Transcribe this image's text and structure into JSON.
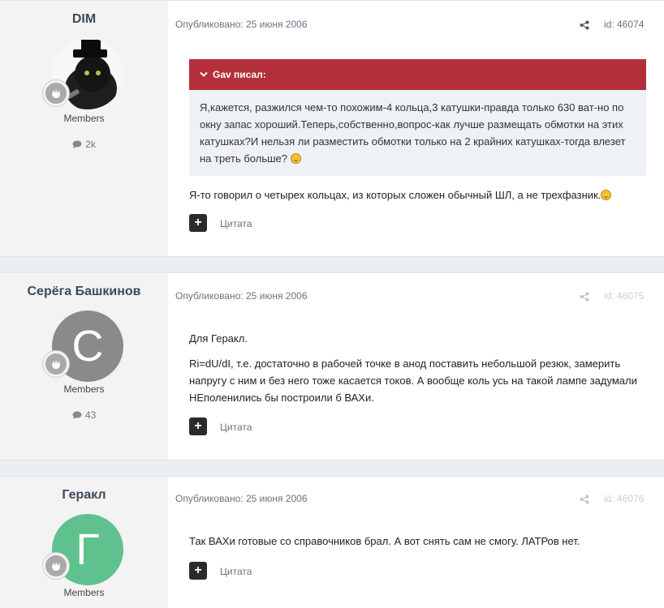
{
  "posts": [
    {
      "author": "DIM",
      "group": "Members",
      "post_count": "2k",
      "published_label": "Опубликовано: 25 июня 2006",
      "id_label": "id: 46074",
      "quote": {
        "author_label": "Gav писал:",
        "text": "Я,кажется, разжился чем-то похожим-4 кольца,3 катушки-правда только 630 ват-но по окну запас хороший.Теперь,собственно,вопрос-как лучше размещать обмотки на этих катушках?И нельзя ли разместить обмотки только на 2 крайних катушках-тогда влезет на треть больше?"
      },
      "text": "Я-то говорил о четырех кольцах, из которых сложен обычный ШЛ, а не трехфазник.",
      "quote_button": "Цитата"
    },
    {
      "author": "Серёга Башкинов",
      "avatar_letter": "С",
      "avatar_color": "#8a8a8a",
      "group": "Members",
      "post_count": "43",
      "published_label": "Опубликовано: 25 июня 2006",
      "id_label": "id: 46075",
      "paragraphs": [
        "Для Геракл.",
        "Ri=dU/dI, т.е. достаточно в рабочей точке в анод поставить небольшой резюк, замерить напругу с ним и без него тоже касается токов. А вообще коль усь на такой лампе задумали НЕполенились бы построили б ВАХи."
      ],
      "quote_button": "Цитата"
    },
    {
      "author": "Геракл",
      "avatar_letter": "Г",
      "avatar_color": "#5fc28e",
      "group": "Members",
      "published_label": "Опубликовано: 25 июня 2006",
      "id_label": "id: 46076",
      "text": "Так ВАХи готовые со справочников брал. А вот снять сам не смогу. ЛАТРов нет.",
      "quote_button": "Цитата"
    }
  ]
}
